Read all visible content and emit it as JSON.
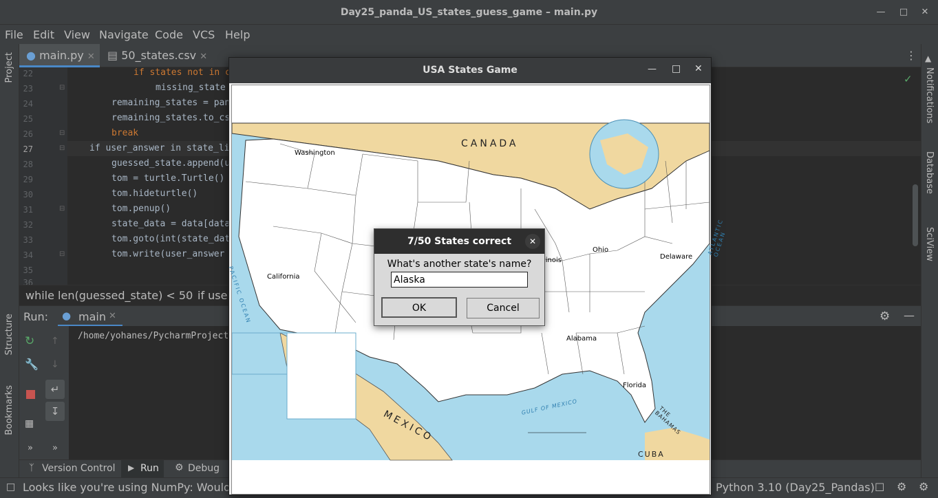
{
  "window_title": "Day25_panda_US_states_guess_game – main.py",
  "menu": [
    "File",
    "Edit",
    "View",
    "Navigate",
    "Code",
    "VCS",
    "Help"
  ],
  "tabs": [
    {
      "label": "main.py"
    },
    {
      "label": "50_states.csv"
    }
  ],
  "left_tools": {
    "project": "Project",
    "structure": "Structure",
    "bookmarks": "Bookmarks"
  },
  "right_tools": {
    "notifications": "Notifications",
    "database": "Database",
    "sciview": "SciView"
  },
  "code_lines": [
    {
      "num": "22",
      "text": "if states not in c"
    },
    {
      "num": "23",
      "text": "missing_state"
    },
    {
      "num": "24",
      "text": "remaining_states = pan"
    },
    {
      "num": "25",
      "text": "remaining_states.to_cs"
    },
    {
      "num": "26",
      "text": "break"
    },
    {
      "num": "27",
      "text": "if user_answer in state_li"
    },
    {
      "num": "28",
      "text": "guessed_state.append(u"
    },
    {
      "num": "29",
      "text": "tom = turtle.Turtle()"
    },
    {
      "num": "30",
      "text": "tom.hideturtle()"
    },
    {
      "num": "31",
      "text": "tom.penup()"
    },
    {
      "num": "32",
      "text": "state_data = data[data"
    },
    {
      "num": "33",
      "text": "tom.goto(int(state_dat"
    },
    {
      "num": "34",
      "text": "tom.write(user_answer"
    },
    {
      "num": "35",
      "text": ""
    },
    {
      "num": "36",
      "text": ""
    }
  ],
  "breadcrumb": {
    "first": "while len(guessed_state) < 50",
    "second": "if user"
  },
  "run": {
    "label": "Run:",
    "config": "main",
    "console_text": "/home/yohanes/PycharmProject"
  },
  "bottom_tabs": {
    "vcs": "Version Control",
    "run": "Run",
    "debug": "Debug"
  },
  "status": {
    "message": "Looks like you're using NumPy: Would y",
    "interpreter": "Python 3.10 (Day25_Pandas)"
  },
  "game_window": {
    "title": "USA States Game"
  },
  "map": {
    "countries": {
      "canada": "CANADA",
      "mexico": "MEXICO",
      "cuba": "CUBA",
      "bahamas": "THE BAHAMAS"
    },
    "oceans": {
      "pacific": "PACIFIC OCEAN",
      "atlantic": "ATLANTIC OCEAN",
      "gulf": "GULF OF MEXICO"
    },
    "state_labels": [
      "Washington",
      "California",
      "Ohio",
      "Delaware",
      "Alabama",
      "Florida",
      "linois"
    ]
  },
  "dialog": {
    "title": "7/50 States correct",
    "prompt": "What's another state's name?",
    "input_value": "Alaska",
    "ok": "OK",
    "cancel": "Cancel"
  },
  "colors": {
    "ide_bg": "#2b2b2b",
    "panel": "#3c3f41",
    "keyword": "#cc7832",
    "land": "#ffffff",
    "water": "#a9d9ec",
    "foreign_land": "#f0d8a0"
  }
}
